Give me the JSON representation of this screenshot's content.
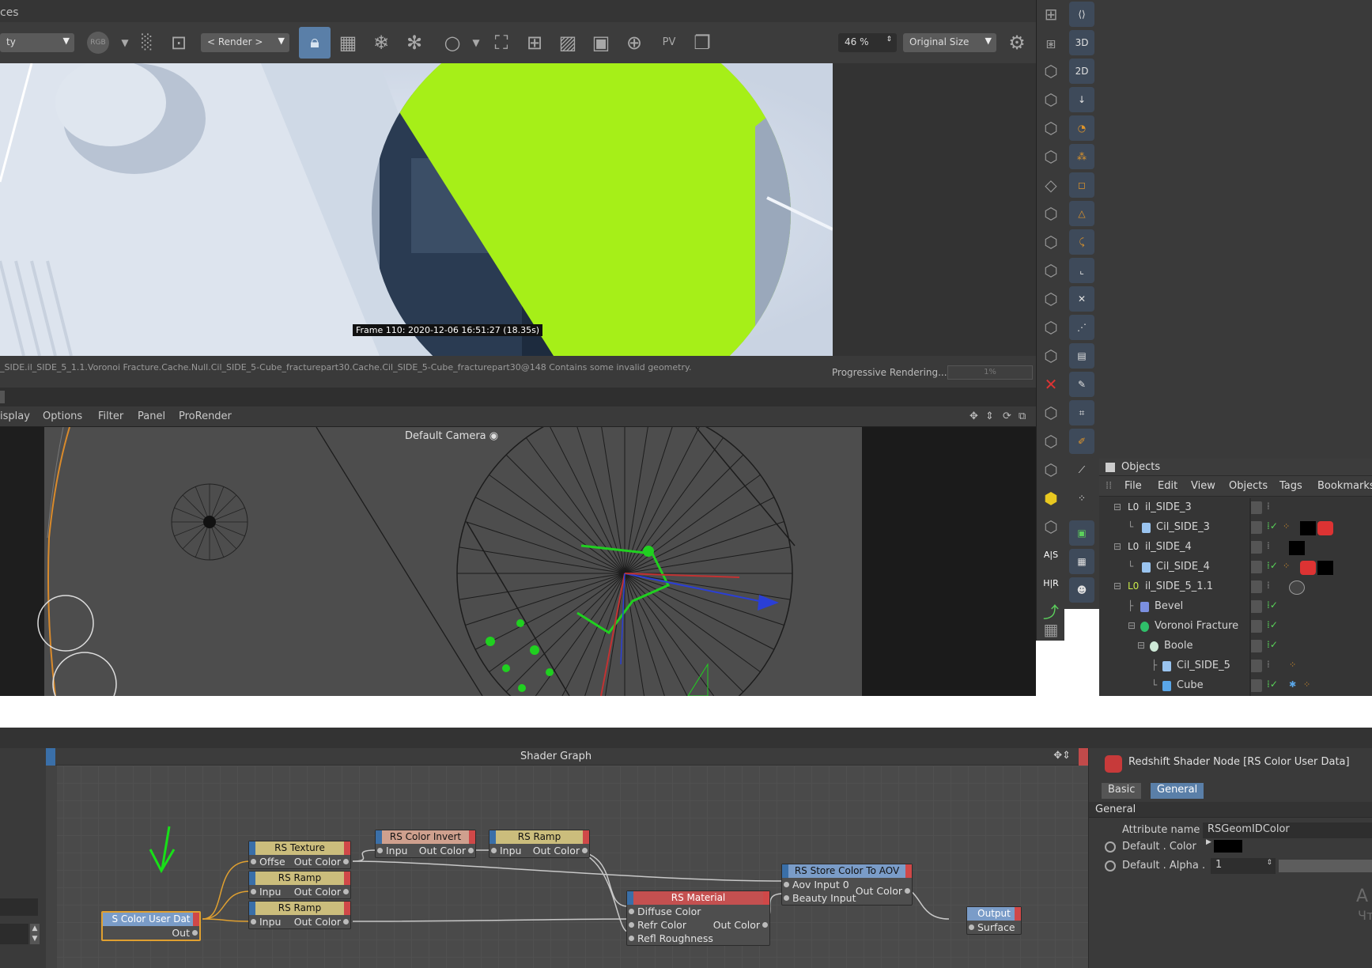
{
  "picture_viewer": {
    "title_fragment": "ces",
    "toolbar": {
      "preset_dropdown": "ty",
      "rgb_label": "RGB",
      "render_dropdown": "< Render >",
      "zoom_value": "46 %",
      "size_dropdown": "Original Size"
    },
    "overlay_text": "Frame  110:  2020-12-06  16:51:27  (18.35s)",
    "status_message": "_SIDE.il_SIDE_5_1.1.Voronoi Fracture.Cache.Null.Cil_SIDE_5-Cube_fracturepart30.Cache.Cil_SIDE_5-Cube_fracturepart30@148  Contains some invalid geometry.",
    "progress_label": "Progressive Rendering...",
    "progress_value": "1%"
  },
  "viewport": {
    "menu": [
      "isplay",
      "Options",
      "Filter",
      "Panel",
      "ProRender"
    ],
    "camera_label": "Default Camera"
  },
  "side_palette": {
    "labels": [
      "3D",
      "2D"
    ]
  },
  "objects_panel": {
    "title": "Objects",
    "menu": [
      "File",
      "Edit",
      "View",
      "Objects",
      "Tags",
      "Bookmarks"
    ],
    "rows": [
      {
        "name": "il_SIDE_3"
      },
      {
        "name": "Cil_SIDE_3"
      },
      {
        "name": "il_SIDE_4"
      },
      {
        "name": "Cil_SIDE_4"
      },
      {
        "name": "il_SIDE_5_1.1"
      },
      {
        "name": "Bevel"
      },
      {
        "name": "Voronoi Fracture"
      },
      {
        "name": "Boole"
      },
      {
        "name": "Cil_SIDE_5"
      },
      {
        "name": "Cube"
      }
    ]
  },
  "shader_graph": {
    "title": "Shader Graph",
    "nodes": {
      "color_user_data": {
        "title": "S Color User Dat",
        "out": "Out"
      },
      "texture": {
        "title": "RS Texture",
        "in": "Offse",
        "out": "Out Color"
      },
      "ramp1": {
        "title": "RS Ramp",
        "in": "Inpu",
        "out": "Out Color"
      },
      "ramp2": {
        "title": "RS Ramp",
        "in": "Inpu",
        "out": "Out Color"
      },
      "color_invert": {
        "title": "RS Color Invert",
        "in": "Inpu",
        "out": "Out Color"
      },
      "ramp3": {
        "title": "RS Ramp",
        "in": "Inpu",
        "out": "Out Color"
      },
      "material": {
        "title": "RS Material",
        "in1": "Diffuse Color",
        "in2": "Refr Color",
        "out": "Out Color",
        "in3": "Refl Roughness"
      },
      "store_aov": {
        "title": "RS Store Color To AOV",
        "in1": "Aov Input 0",
        "in2": "Beauty Input",
        "out": "Out Color"
      },
      "output": {
        "title": "Output",
        "in": "Surface"
      }
    }
  },
  "attributes": {
    "header": "Redshift Shader Node [RS Color User Data]",
    "tabs": [
      "Basic",
      "General"
    ],
    "group": "General",
    "attr_name_label": "Attribute name",
    "attr_name_value": "RSGeomIDColor",
    "default_color_label": "Default . Color",
    "default_alpha_label": "Default . Alpha .",
    "default_alpha_value": "1",
    "ghost1": "A",
    "ghost2": "Чт"
  }
}
